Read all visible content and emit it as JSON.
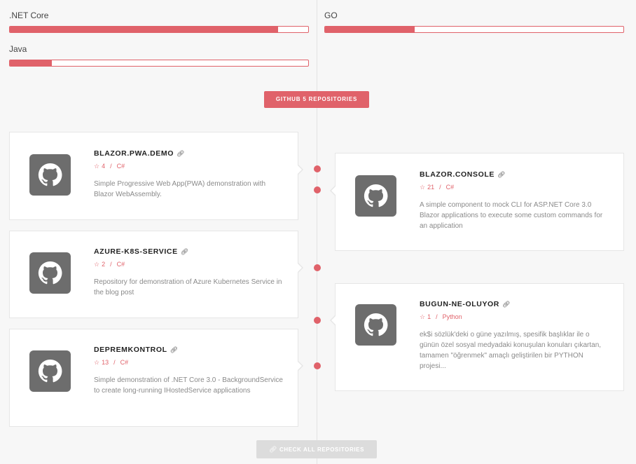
{
  "skills": [
    {
      "label": ".NET Core",
      "level": 0.9
    },
    {
      "label": "GO",
      "level": 0.3
    },
    {
      "label": "Java",
      "level": 0.14
    }
  ],
  "section": {
    "badge": "GITHUB 5 REPOSITORIES"
  },
  "repos": [
    {
      "name": "BLAZOR.PWA.DEMO",
      "stars": "4",
      "language": "C#",
      "description": "Simple Progressive Web App(PWA) demonstration with Blazor WebAssembly."
    },
    {
      "name": "BLAZOR.CONSOLE",
      "stars": "21",
      "language": "C#",
      "description": "A simple component to mock CLI for ASP.NET Core 3.0 Blazor applications to execute some custom commands for an application"
    },
    {
      "name": "AZURE-K8S-SERVICE",
      "stars": "2",
      "language": "C#",
      "description": "Repository for demonstration of Azure Kubernetes Service in the blog post"
    },
    {
      "name": "BUGUN-NE-OLUYOR",
      "stars": "1",
      "language": "Python",
      "description": "ek$i sözlük'deki o güne yazılmış, spesifik başlıklar ile o günün özel sosyal medyadaki konuşulan konuları çıkartan, tamamen \"öğrenmek\" amaçlı geliştirilen bir PYTHON projesi..."
    },
    {
      "name": "DEPREMKONTROL",
      "stars": "13",
      "language": "C#",
      "description": "Simple demonstration of .NET Core 3.0 - BackgroundService to create long-running IHostedService applications"
    }
  ],
  "icons": {
    "link": "link-icon",
    "star": "star-icon",
    "repo_logo": "github-icon"
  },
  "colors": {
    "accent": "#e0626a",
    "muted_button": "#dcdcdc",
    "logo_bg": "#6d6d6d"
  },
  "footer": {
    "check_all_label": "CHECK ALL REPOSITORIES"
  }
}
